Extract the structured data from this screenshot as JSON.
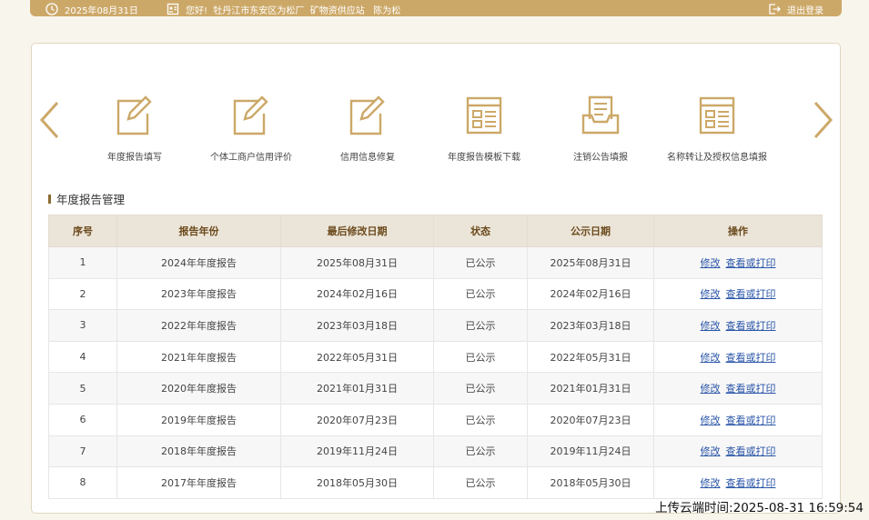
{
  "topbar": {
    "date": "2025年08月31日",
    "greeting": "您好!  牡丹江市东安区为松厂  矿物资供应站   陈为松",
    "logout": "退出登录"
  },
  "functions": [
    {
      "label": "年度报告填写",
      "icon": "edit-document-icon"
    },
    {
      "label": "个体工商户信用评价",
      "icon": "edit-document-icon"
    },
    {
      "label": "信用信息修复",
      "icon": "edit-document-icon"
    },
    {
      "label": "年度报告模板下载",
      "icon": "template-form-icon"
    },
    {
      "label": "注销公告填报",
      "icon": "tray-document-icon"
    },
    {
      "label": "名称转让及授权信息填报",
      "icon": "template-form-icon"
    }
  ],
  "section": {
    "title": "年度报告管理"
  },
  "table": {
    "headers": [
      "序号",
      "报告年份",
      "最后修改日期",
      "状态",
      "公示日期",
      "操作"
    ],
    "edit_label": "修改",
    "view_label": "查看或打印",
    "rows": [
      {
        "no": "1",
        "year": "2024年年度报告",
        "modified": "2025年08月31日",
        "status": "已公示",
        "published": "2025年08月31日"
      },
      {
        "no": "2",
        "year": "2023年年度报告",
        "modified": "2024年02月16日",
        "status": "已公示",
        "published": "2024年02月16日"
      },
      {
        "no": "3",
        "year": "2022年年度报告",
        "modified": "2023年03月18日",
        "status": "已公示",
        "published": "2023年03月18日"
      },
      {
        "no": "4",
        "year": "2021年年度报告",
        "modified": "2022年05月31日",
        "status": "已公示",
        "published": "2022年05月31日"
      },
      {
        "no": "5",
        "year": "2020年年度报告",
        "modified": "2021年01月31日",
        "status": "已公示",
        "published": "2021年01月31日"
      },
      {
        "no": "6",
        "year": "2019年年度报告",
        "modified": "2020年07月23日",
        "status": "已公示",
        "published": "2020年07月23日"
      },
      {
        "no": "7",
        "year": "2018年年度报告",
        "modified": "2019年11月24日",
        "status": "已公示",
        "published": "2019年11月24日"
      },
      {
        "no": "8",
        "year": "2017年年度报告",
        "modified": "2018年05月30日",
        "status": "已公示",
        "published": "2018年05月30日"
      }
    ]
  },
  "upload_stamp": "上传云端时间:2025-08-31 16:59:54",
  "colors": {
    "accent": "#cca868",
    "header_bg": "#ebe4d8",
    "link": "#2a55a8"
  }
}
